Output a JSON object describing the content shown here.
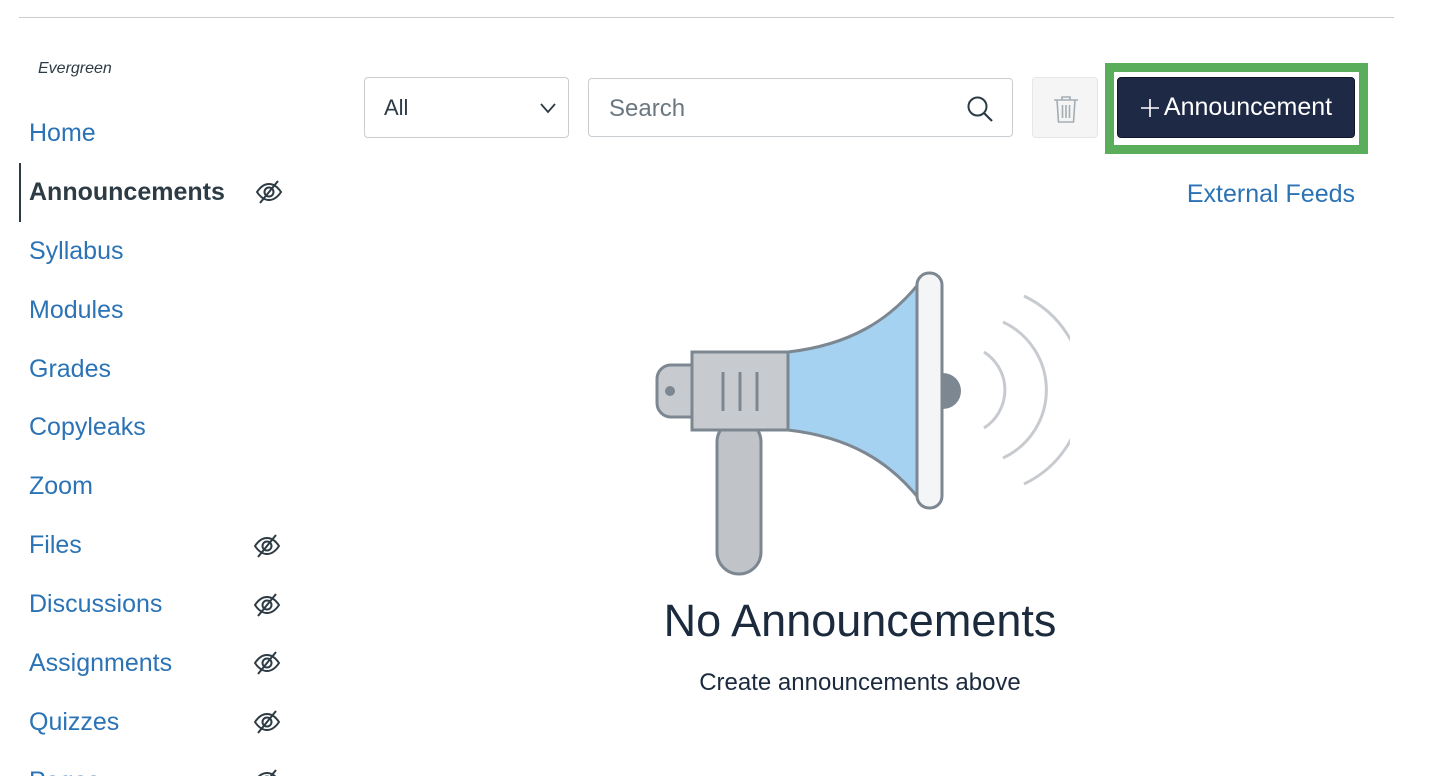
{
  "course": {
    "name": "Evergreen"
  },
  "sidebar": {
    "items": [
      {
        "label": "Home",
        "active": false,
        "hidden": false
      },
      {
        "label": "Announcements",
        "active": true,
        "hidden": true
      },
      {
        "label": "Syllabus",
        "active": false,
        "hidden": false
      },
      {
        "label": "Modules",
        "active": false,
        "hidden": false
      },
      {
        "label": "Grades",
        "active": false,
        "hidden": false
      },
      {
        "label": "Copyleaks",
        "active": false,
        "hidden": false
      },
      {
        "label": "Zoom",
        "active": false,
        "hidden": false
      },
      {
        "label": "Files",
        "active": false,
        "hidden": true
      },
      {
        "label": "Discussions",
        "active": false,
        "hidden": true
      },
      {
        "label": "Assignments",
        "active": false,
        "hidden": true
      },
      {
        "label": "Quizzes",
        "active": false,
        "hidden": true
      },
      {
        "label": "Pages",
        "active": false,
        "hidden": true
      }
    ]
  },
  "toolbar": {
    "filter_value": "All",
    "search_placeholder": "Search",
    "add_label": "Announcement",
    "external_feeds_label": "External Feeds"
  },
  "empty_state": {
    "title": "No Announcements",
    "subtitle": "Create announcements above"
  },
  "colors": {
    "link": "#2b73b5",
    "primary_button": "#1e2a45",
    "highlight": "#5aad5a",
    "megaphone_cone": "#a5d2f0"
  }
}
